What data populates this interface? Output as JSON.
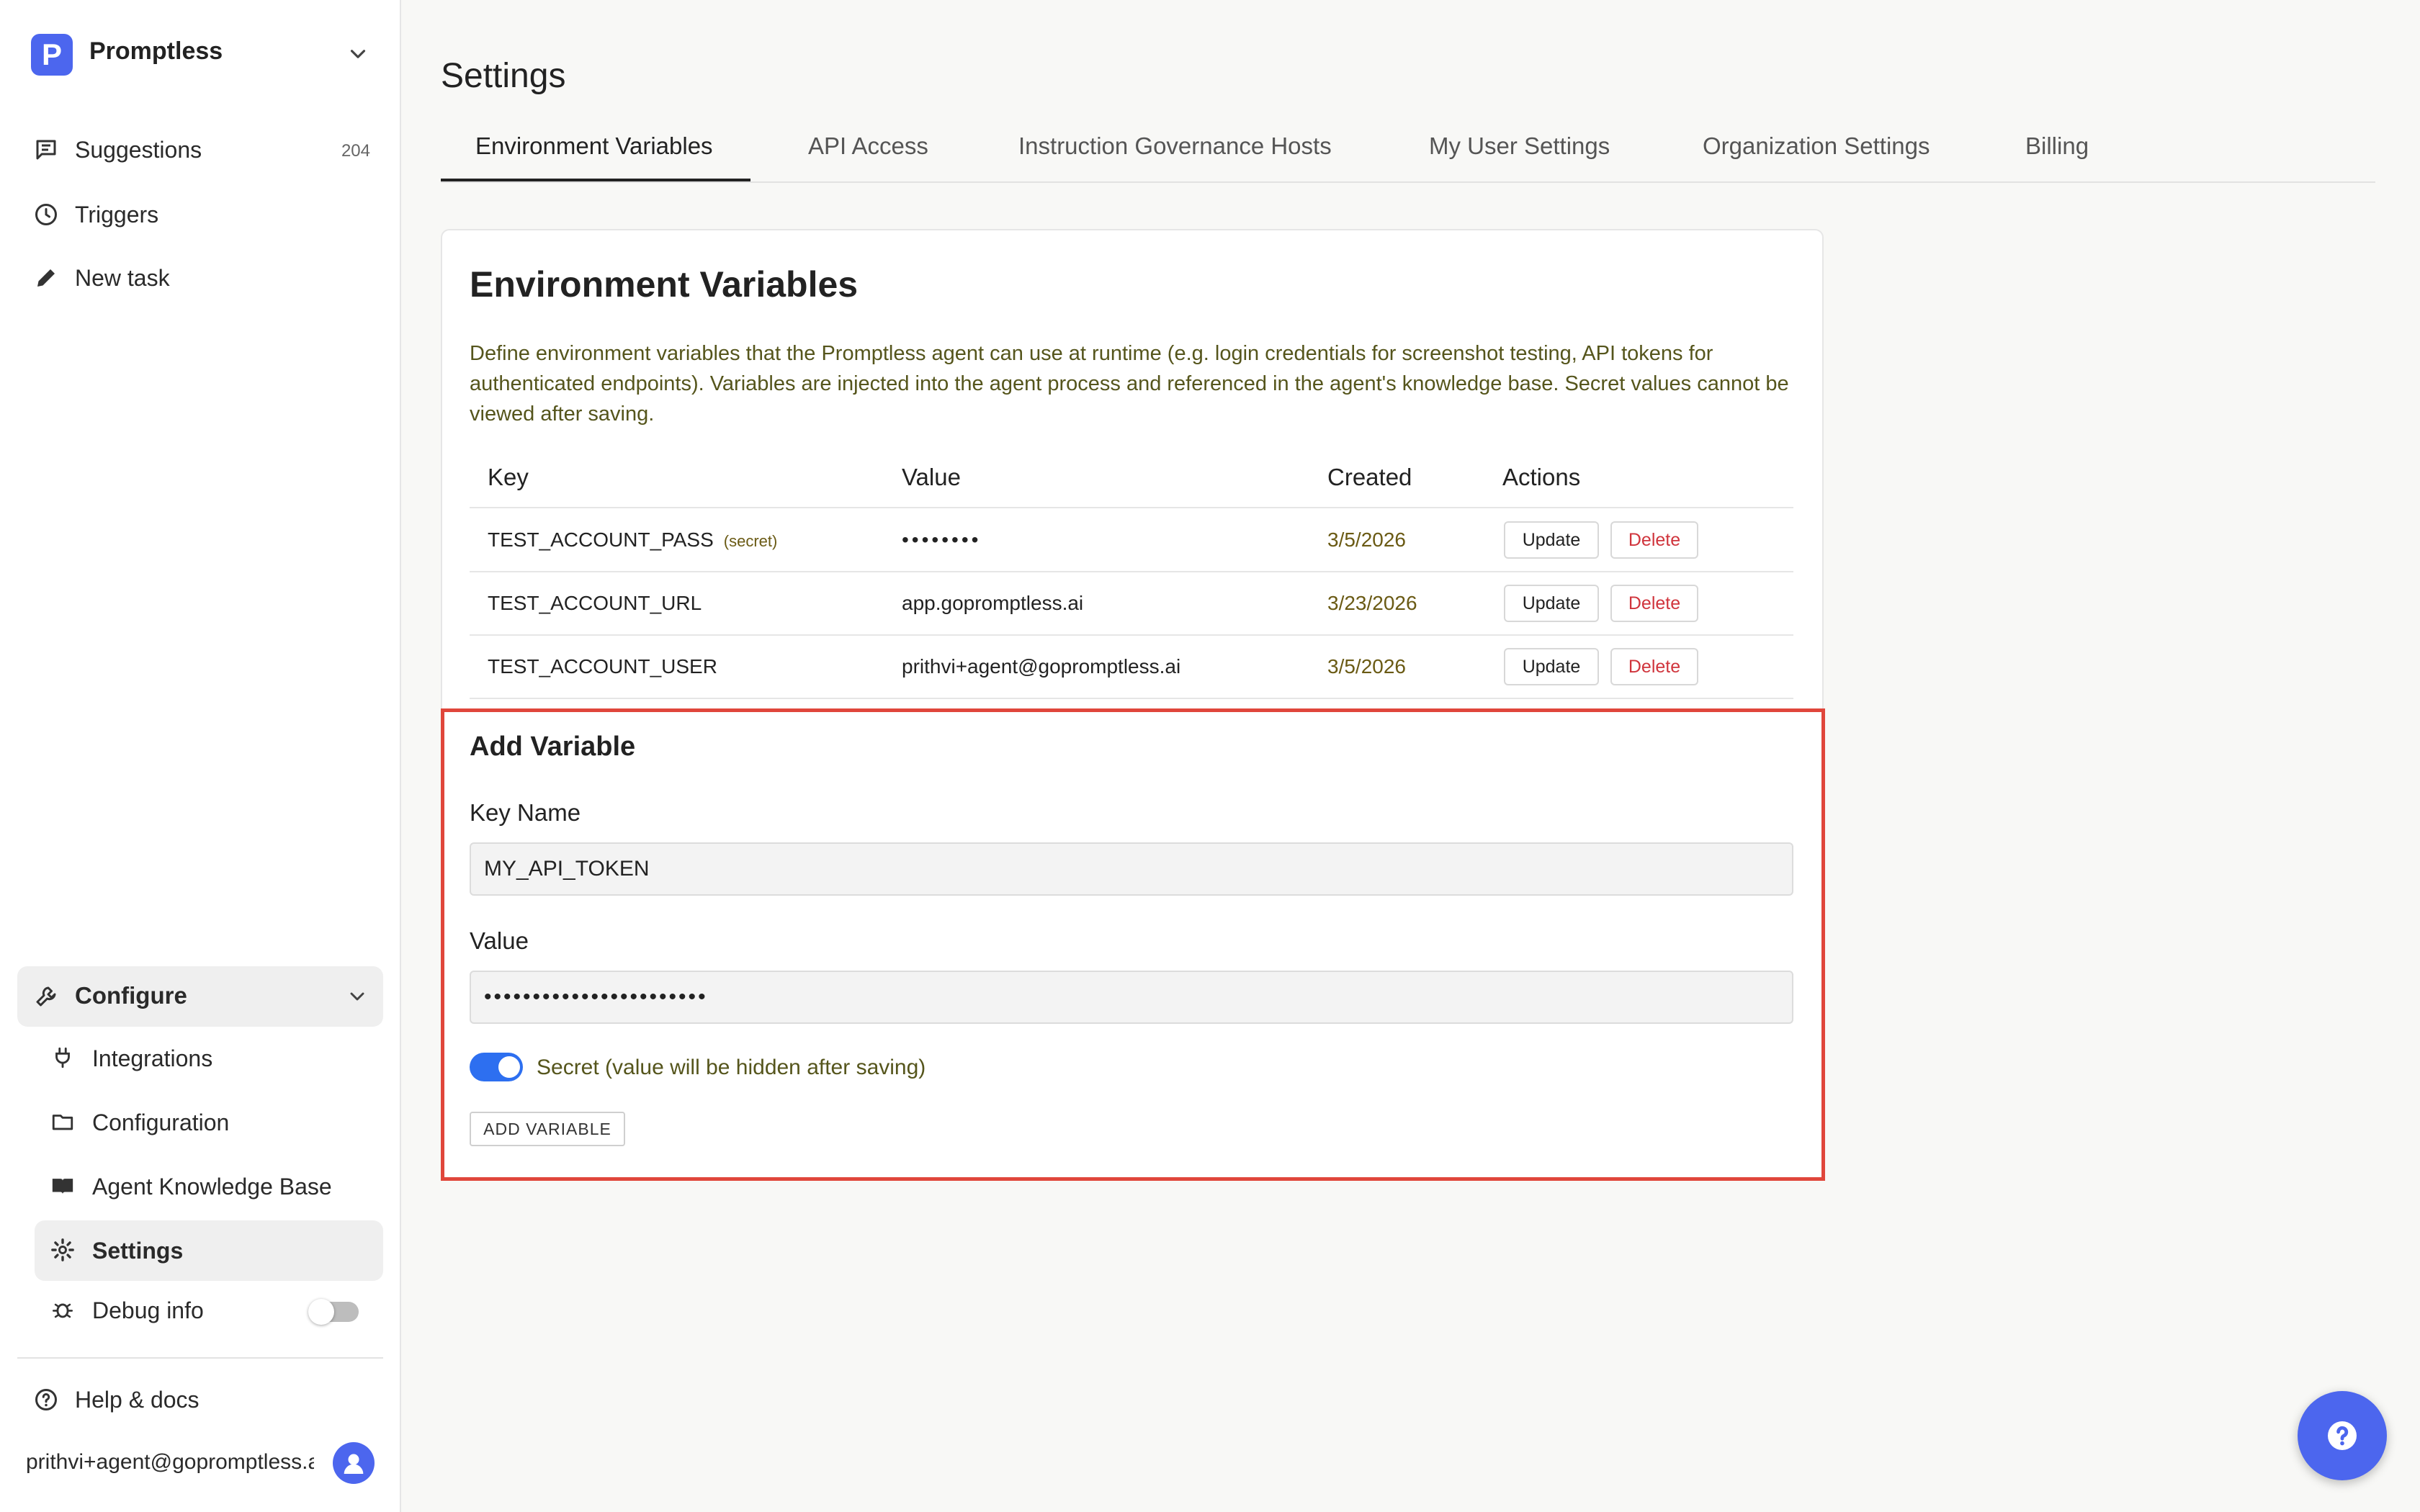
{
  "sidebar": {
    "org_logo_letter": "P",
    "org_name": "Promptless",
    "nav": [
      {
        "label": "Suggestions",
        "count": "204",
        "icon": "message-icon"
      },
      {
        "label": "Triggers",
        "icon": "clock-icon"
      },
      {
        "label": "New task",
        "icon": "pencil-icon"
      }
    ],
    "configure_label": "Configure",
    "config_items": [
      {
        "label": "Integrations",
        "icon": "plug-icon"
      },
      {
        "label": "Configuration",
        "icon": "folder-icon"
      },
      {
        "label": "Agent Knowledge Base",
        "icon": "book-icon"
      },
      {
        "label": "Settings",
        "icon": "gear-icon",
        "active": true
      },
      {
        "label": "Debug info",
        "icon": "bug-icon"
      }
    ],
    "debug_toggle_on": false,
    "help_label": "Help & docs",
    "user_email": "prithvi+agent@gopromptless.ai"
  },
  "main": {
    "title": "Settings",
    "tabs": [
      {
        "label": "Environment Variables",
        "active": true
      },
      {
        "label": "API Access"
      },
      {
        "label": "Instruction Governance Hosts"
      },
      {
        "label": "My User Settings"
      },
      {
        "label": "Organization Settings"
      },
      {
        "label": "Billing"
      }
    ],
    "card": {
      "title": "Environment Variables",
      "description": "Define environment variables that the Promptless agent can use at runtime (e.g. login credentials for screenshot testing, API tokens for authenticated endpoints). Variables are injected into the agent process and referenced in the agent's knowledge base. Secret values cannot be viewed after saving.",
      "columns": [
        "Key",
        "Value",
        "Created",
        "Actions"
      ],
      "rows": [
        {
          "key": "TEST_ACCOUNT_PASS",
          "tag": "(secret)",
          "value": "••••••••",
          "created": "3/5/2026"
        },
        {
          "key": "TEST_ACCOUNT_URL",
          "tag": "",
          "value": "app.gopromptless.ai",
          "created": "3/23/2026"
        },
        {
          "key": "TEST_ACCOUNT_USER",
          "tag": "",
          "value": "prithvi+agent@gopromptless.ai",
          "created": "3/5/2026"
        }
      ],
      "update_label": "Update",
      "delete_label": "Delete"
    },
    "add_form": {
      "title": "Add Variable",
      "key_label": "Key Name",
      "key_value": "MY_API_TOKEN",
      "value_label": "Value",
      "value_value": "•••••••••••••••••••••••",
      "secret_on": true,
      "secret_label": "Secret (value will be hidden after saving)",
      "submit_label": "ADD VARIABLE"
    }
  },
  "colors": {
    "brand": "#4c66ee",
    "toggle_on": "#2d6ff0",
    "delete_text": "#d0343c",
    "highlight_border": "#e0463b"
  }
}
